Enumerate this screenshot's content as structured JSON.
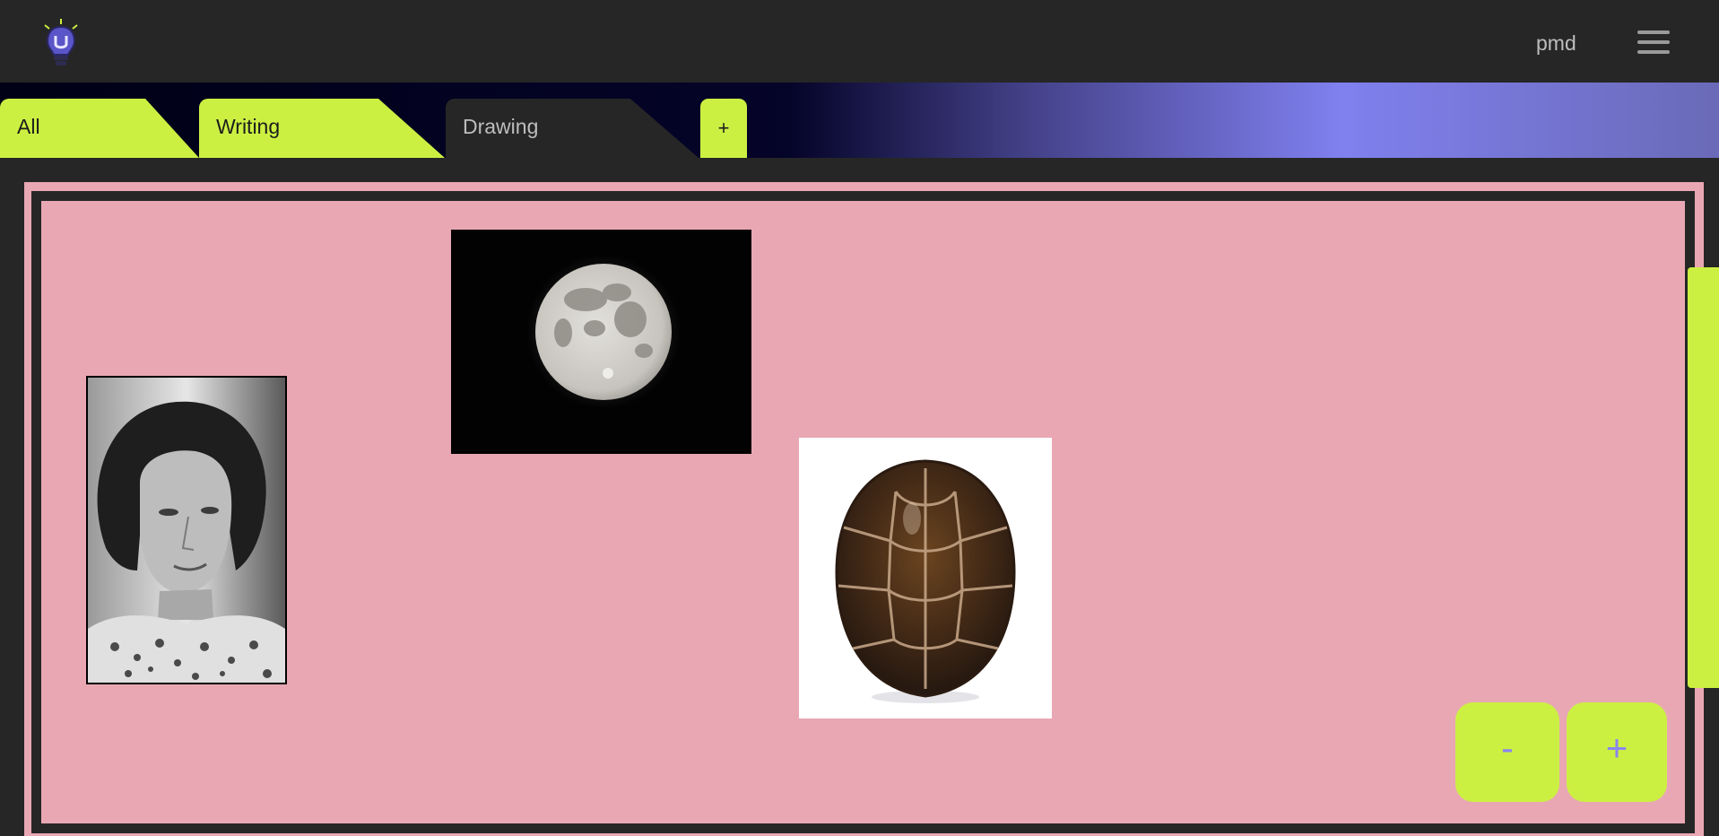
{
  "header": {
    "logo_icon": "lightbulb-logo-icon",
    "username": "pmd",
    "menu_icon": "hamburger-menu-icon"
  },
  "tabs": [
    {
      "label": "All",
      "state": "active"
    },
    {
      "label": "Writing",
      "state": "active"
    },
    {
      "label": "Drawing",
      "state": "selected"
    },
    {
      "label": "+",
      "state": "add"
    }
  ],
  "board": {
    "images": [
      {
        "name": "portrait-photo",
        "subject": "black and white portrait"
      },
      {
        "name": "moon-photo",
        "subject": "full moon"
      },
      {
        "name": "turtle-shell-photo",
        "subject": "turtle shell"
      }
    ]
  },
  "zoom": {
    "out_label": "-",
    "in_label": "+"
  },
  "colors": {
    "accent": "#ccf042",
    "board": "#e9a7b4",
    "background": "#262626",
    "zoom_text": "#8a86ee"
  }
}
